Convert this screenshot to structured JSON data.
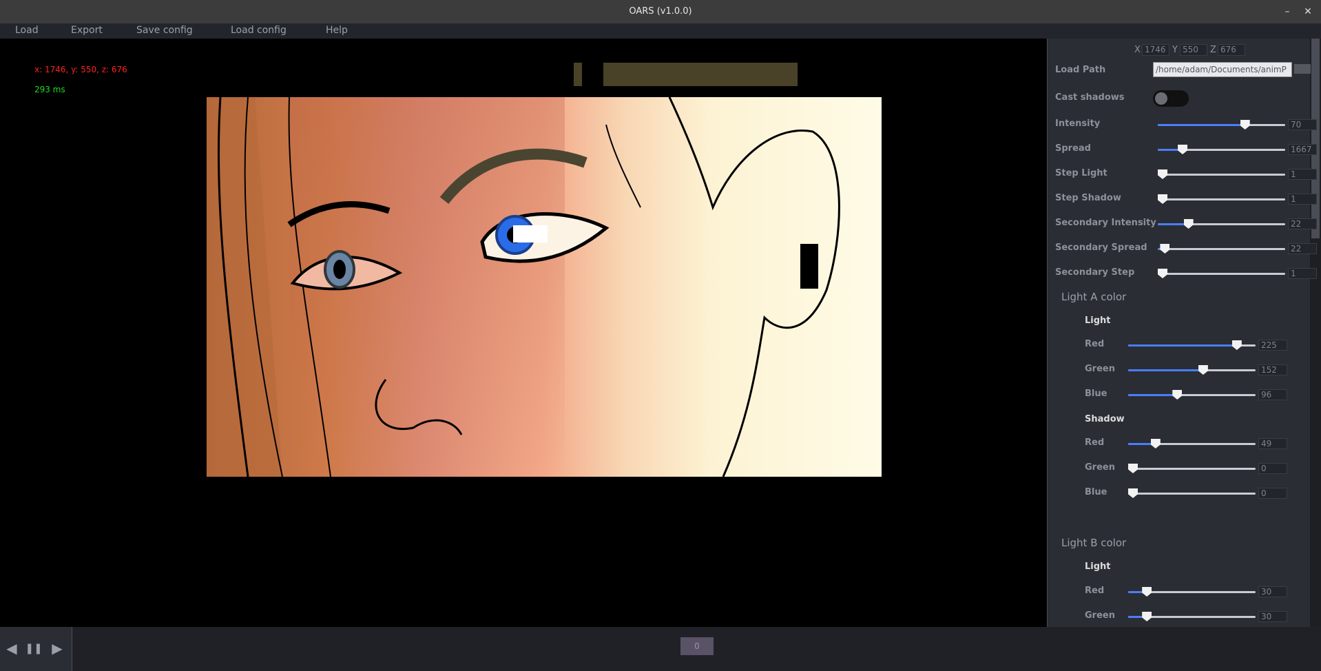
{
  "window": {
    "title": "OARS (v1.0.0)",
    "minimize_glyph": "–",
    "close_glyph": "✕"
  },
  "menu": [
    {
      "label": "Load"
    },
    {
      "label": "Export"
    },
    {
      "label": "Save config"
    },
    {
      "label": "Load config"
    },
    {
      "label": "Help"
    }
  ],
  "viewport": {
    "coords": "x: 1746, y: 550, z: 676",
    "timing": "293 ms",
    "coords_color": "#ff2020",
    "timing_color": "#22dd22",
    "status_bar_a_color": "#4a4228",
    "status_bar_b_color": "#4a4228"
  },
  "panel": {
    "xyz": {
      "x_label": "X",
      "x_value": "1746",
      "y_label": "Y",
      "y_value": "550",
      "z_label": "Z",
      "z_value": "676"
    },
    "load_path": {
      "label": "Load Path",
      "value": "/home/adam/Documents/animP"
    },
    "cast_shadows": {
      "label": "Cast shadows",
      "on": false
    },
    "sliders": [
      {
        "label": "Intensity",
        "value": "70",
        "fraction": 0.7
      },
      {
        "label": "Spread",
        "value": "1667",
        "fraction": 0.17
      },
      {
        "label": "Step Light",
        "value": "1",
        "fraction": 0.0
      },
      {
        "label": "Step Shadow",
        "value": "1",
        "fraction": 0.0
      },
      {
        "label": "Secondary Intensity",
        "value": "22",
        "fraction": 0.22
      },
      {
        "label": "Secondary Spread",
        "value": "22",
        "fraction": 0.02
      },
      {
        "label": "Secondary Step",
        "value": "1",
        "fraction": 0.0
      }
    ],
    "light_a": {
      "title": "Light A color",
      "light_title": "Light",
      "shadow_title": "Shadow",
      "light": [
        {
          "label": "Red",
          "value": "225",
          "fraction": 0.882
        },
        {
          "label": "Green",
          "value": "152",
          "fraction": 0.596
        },
        {
          "label": "Blue",
          "value": "96",
          "fraction": 0.376
        }
      ],
      "shadow": [
        {
          "label": "Red",
          "value": "49",
          "fraction": 0.192
        },
        {
          "label": "Green",
          "value": "0",
          "fraction": 0.0
        },
        {
          "label": "Blue",
          "value": "0",
          "fraction": 0.0
        }
      ]
    },
    "light_b": {
      "title": "Light B color",
      "light_title": "Light",
      "light": [
        {
          "label": "Red",
          "value": "30",
          "fraction": 0.118
        },
        {
          "label": "Green",
          "value": "30",
          "fraction": 0.118
        }
      ]
    }
  },
  "player": {
    "prev_icon": "◀",
    "pause_icon": "❚❚",
    "next_icon": "▶",
    "frame": "0"
  }
}
